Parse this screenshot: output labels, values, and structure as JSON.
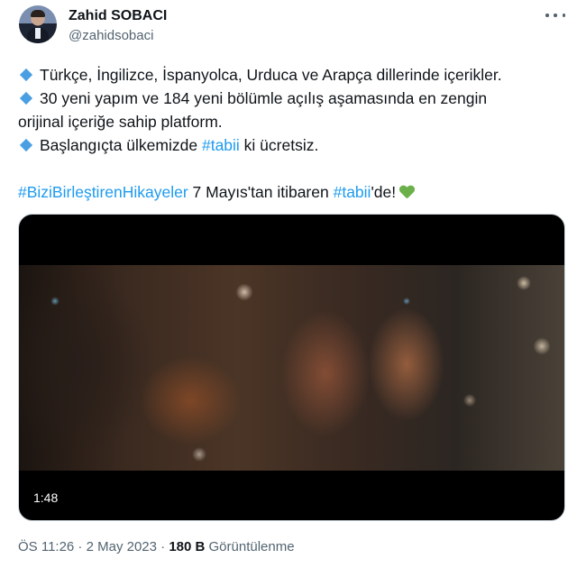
{
  "author": {
    "name": "Zahid SOBACI",
    "handle": "@zahidsobaci"
  },
  "tweet": {
    "bullet_color": "#4a9fe3",
    "line1": "Türkçe, İngilizce, İspanyolca, Urduca ve Arapça dillerinde içerikler.",
    "line2a": "30 yeni yapım ve 184 yeni bölümle açılış aşamasında en zengin",
    "line2b": "orijinal içeriğe sahip platform.",
    "line3_prefix": "Başlangıçta ülkemizde ",
    "line3_tag": "#tabii",
    "line3_suffix": " ki ücretsiz.",
    "line4_tag1": "#BiziBirleştirenHikayeler",
    "line4_mid": " 7 Mayıs'tan itibaren ",
    "line4_tag2": "#tabii",
    "line4_suffix": "'de!",
    "emoji": "green-heart",
    "link_color": "#1d9bf0"
  },
  "video": {
    "duration": "1:48"
  },
  "footer": {
    "time_date": "ÖS 11:26 · 2 May 2023 · ",
    "views_count": "180 B",
    "views_label": " Görüntülenme"
  }
}
